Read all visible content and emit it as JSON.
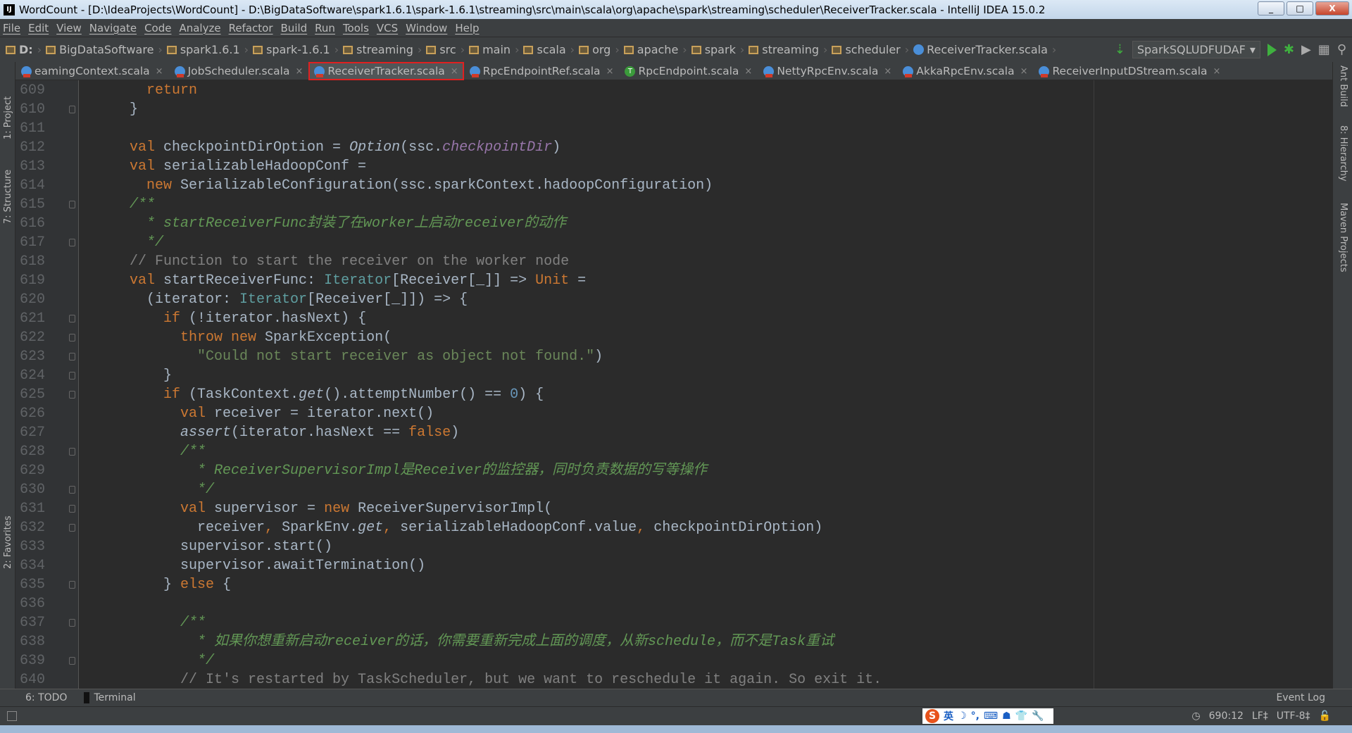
{
  "window": {
    "title": "WordCount - [D:\\IdeaProjects\\WordCount] - D:\\BigDataSoftware\\spark1.6.1\\spark-1.6.1\\streaming\\src\\main\\scala\\org\\apache\\spark\\streaming\\scheduler\\ReceiverTracker.scala - IntelliJ IDEA 15.0.2",
    "logo": "IJ",
    "minimize": "_",
    "maximize": "□",
    "close": "X"
  },
  "menu": [
    "File",
    "Edit",
    "View",
    "Navigate",
    "Code",
    "Analyze",
    "Refactor",
    "Build",
    "Run",
    "Tools",
    "VCS",
    "Window",
    "Help"
  ],
  "breadcrumb": [
    "D:",
    "BigDataSoftware",
    "spark1.6.1",
    "spark-1.6.1",
    "streaming",
    "src",
    "main",
    "scala",
    "org",
    "apache",
    "spark",
    "streaming",
    "scheduler",
    "ReceiverTracker.scala"
  ],
  "run_config": "SparkSQLUDFUDAF",
  "tabs": [
    {
      "label": "eamingContext.scala",
      "kind": "class"
    },
    {
      "label": "JobScheduler.scala",
      "kind": "class"
    },
    {
      "label": "ReceiverTracker.scala",
      "kind": "class",
      "active": true
    },
    {
      "label": "RpcEndpointRef.scala",
      "kind": "class"
    },
    {
      "label": "RpcEndpoint.scala",
      "kind": "trait",
      "glyph": "T"
    },
    {
      "label": "NettyRpcEnv.scala",
      "kind": "class"
    },
    {
      "label": "AkkaRpcEnv.scala",
      "kind": "class"
    },
    {
      "label": "ReceiverInputDStream.scala",
      "kind": "class"
    }
  ],
  "left_tools": [
    "1: Project",
    "7: Structure",
    "2: Favorites"
  ],
  "right_tools": [
    "Ant Build",
    "8: Hierarchy",
    "Maven Projects"
  ],
  "editor": {
    "lines": [
      {
        "n": "609",
        "t": [
          [
            "",
            "      "
          ],
          [
            "kw",
            "return"
          ]
        ]
      },
      {
        "n": "610",
        "f": 1,
        "t": [
          [
            "",
            "    }"
          ]
        ]
      },
      {
        "n": "611",
        "t": []
      },
      {
        "n": "612",
        "t": [
          [
            "kw",
            "    val "
          ],
          [
            "",
            "checkpointDirOption = "
          ],
          [
            "it",
            "Option"
          ],
          [
            "",
            "(ssc."
          ],
          [
            "pu",
            "checkpointDir"
          ],
          [
            "",
            ")"
          ]
        ]
      },
      {
        "n": "613",
        "t": [
          [
            "kw",
            "    val "
          ],
          [
            "",
            "serializableHadoopConf ="
          ]
        ]
      },
      {
        "n": "614",
        "t": [
          [
            "kw",
            "      new "
          ],
          [
            "",
            "SerializableConfiguration(ssc.sparkContext.hadoopConfiguration)"
          ]
        ]
      },
      {
        "n": "615",
        "f": 1,
        "t": [
          [
            "doc",
            "    /**"
          ]
        ]
      },
      {
        "n": "616",
        "t": [
          [
            "doc",
            "      * startReceiverFunc封装了在worker上启动receiver的动作"
          ]
        ]
      },
      {
        "n": "617",
        "f": 1,
        "t": [
          [
            "doc",
            "      */"
          ]
        ]
      },
      {
        "n": "618",
        "t": [
          [
            "cm",
            "    // Function to start the receiver on the worker node"
          ]
        ]
      },
      {
        "n": "619",
        "t": [
          [
            "kw",
            "    val "
          ],
          [
            "",
            "startReceiverFunc: "
          ],
          [
            "ty",
            "Iterator"
          ],
          [
            "",
            "[Receiver[_]] => "
          ],
          [
            "kw",
            "Unit"
          ],
          [
            "",
            " ="
          ]
        ]
      },
      {
        "n": "620",
        "t": [
          [
            "",
            "      (iterator: "
          ],
          [
            "ty",
            "Iterator"
          ],
          [
            "",
            "[Receiver[_]]) => {"
          ]
        ]
      },
      {
        "n": "621",
        "f": 1,
        "t": [
          [
            "kw",
            "        if "
          ],
          [
            "",
            "(!iterator.hasNext) {"
          ]
        ]
      },
      {
        "n": "622",
        "f": 1,
        "t": [
          [
            "kw",
            "          throw new "
          ],
          [
            "",
            "SparkException("
          ]
        ]
      },
      {
        "n": "623",
        "f": 1,
        "t": [
          [
            "str",
            "            \"Could not start receiver as object not found.\""
          ],
          [
            "",
            ")"
          ]
        ]
      },
      {
        "n": "624",
        "f": 1,
        "t": [
          [
            "",
            "        }"
          ]
        ]
      },
      {
        "n": "625",
        "f": 1,
        "t": [
          [
            "kw",
            "        if "
          ],
          [
            "",
            "(TaskContext."
          ],
          [
            "it",
            "get"
          ],
          [
            "",
            "().attemptNumber() == "
          ],
          [
            "num",
            "0"
          ],
          [
            "",
            ") {"
          ]
        ]
      },
      {
        "n": "626",
        "t": [
          [
            "kw",
            "          val "
          ],
          [
            "",
            "receiver = iterator.next()"
          ]
        ]
      },
      {
        "n": "627",
        "t": [
          [
            "it",
            "          assert"
          ],
          [
            "",
            "(iterator.hasNext == "
          ],
          [
            "kw",
            "false"
          ],
          [
            "",
            ")"
          ]
        ]
      },
      {
        "n": "628",
        "f": 1,
        "t": [
          [
            "doc",
            "          /**"
          ]
        ]
      },
      {
        "n": "629",
        "t": [
          [
            "doc",
            "            * ReceiverSupervisorImpl是Receiver的监控器，同时负责数据的写等操作"
          ]
        ]
      },
      {
        "n": "630",
        "f": 1,
        "t": [
          [
            "doc",
            "            */"
          ]
        ]
      },
      {
        "n": "631",
        "f": 1,
        "t": [
          [
            "kw",
            "          val "
          ],
          [
            "",
            "supervisor = "
          ],
          [
            "kw",
            "new "
          ],
          [
            "",
            "ReceiverSupervisorImpl("
          ]
        ]
      },
      {
        "n": "632",
        "f": 1,
        "t": [
          [
            "",
            "            receiver"
          ],
          [
            "kw",
            ", "
          ],
          [
            "",
            "SparkEnv."
          ],
          [
            "it",
            "get"
          ],
          [
            "kw",
            ", "
          ],
          [
            "",
            "serializableHadoopConf.value"
          ],
          [
            "kw",
            ", "
          ],
          [
            "",
            "checkpointDirOption)"
          ]
        ]
      },
      {
        "n": "633",
        "t": [
          [
            "",
            "          supervisor.start()"
          ]
        ]
      },
      {
        "n": "634",
        "t": [
          [
            "",
            "          supervisor.awaitTermination()"
          ]
        ]
      },
      {
        "n": "635",
        "f": 1,
        "t": [
          [
            "",
            "        } "
          ],
          [
            "kw",
            "else"
          ],
          [
            "",
            " {"
          ]
        ]
      },
      {
        "n": "636",
        "t": []
      },
      {
        "n": "637",
        "f": 1,
        "t": [
          [
            "doc",
            "          /**"
          ]
        ]
      },
      {
        "n": "638",
        "t": [
          [
            "doc",
            "            * 如果你想重新启动receiver的话，你需要重新完成上面的调度，从新schedule，而不是Task重试"
          ]
        ]
      },
      {
        "n": "639",
        "f": 1,
        "t": [
          [
            "doc",
            "            */"
          ]
        ]
      },
      {
        "n": "640",
        "t": [
          [
            "cm",
            "          // It's restarted by TaskScheduler, but we want to reschedule it again. So exit it."
          ]
        ]
      }
    ]
  },
  "toolwindows": {
    "todo": "6: TODO",
    "terminal": "Terminal",
    "event_log": "Event Log"
  },
  "status": {
    "position": "690:12",
    "line_sep": "LF‡",
    "encoding": "UTF-8‡",
    "ime": [
      "英",
      "☽",
      "°,",
      "⌨",
      "☗",
      "👕",
      "🔧"
    ],
    "ime_logo": "S"
  },
  "colors": {
    "keyword": "#cc7832",
    "comment": "#808080",
    "doc": "#629755",
    "string": "#6a8759",
    "number": "#6897bb",
    "tab_highlight": "#e02020"
  }
}
